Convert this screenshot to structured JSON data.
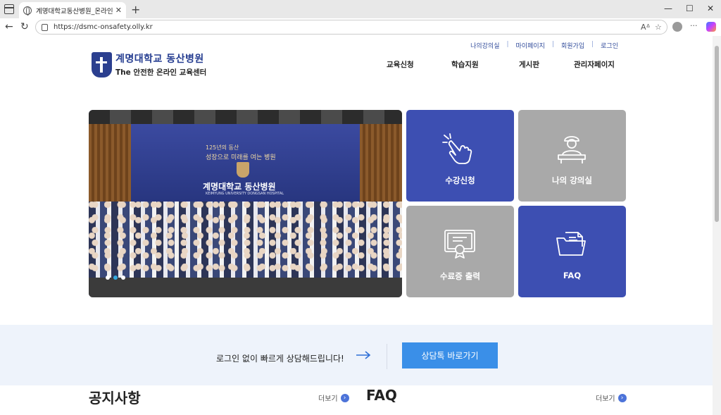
{
  "browser": {
    "tab_title": "계명대학교동산병원_온라인교육",
    "tab_close": "✕",
    "new_tab": "+",
    "url": "https://dsmc-onsafety.olly.kr",
    "window_controls": [
      "—",
      "☐",
      "✕"
    ]
  },
  "util_nav": [
    "나의강의실",
    "마이페이지",
    "회원가입",
    "로그인"
  ],
  "util_separator": "|",
  "logo": {
    "main": "계명대학교 동산병원",
    "sub": "The 안전한 온라인 교육센터"
  },
  "main_nav": [
    "교육신청",
    "학습지원",
    "게시판",
    "관리자페이지"
  ],
  "hero": {
    "banner_line1": "125년의 동산",
    "banner_line2": "성장으로 미래를 여는 병원",
    "banner_title": "계명대학교 동산병원",
    "banner_en": "KEIMYUNG UNIVERSITY DONGSAN HOSPITAL",
    "slide_count": 3,
    "active_slide": 2
  },
  "tiles": [
    {
      "label": "수강신청",
      "icon": "hand-click-icon",
      "color": "#3d4fb2"
    },
    {
      "label": "나의 강의실",
      "icon": "student-desk-icon",
      "color": "#a9a9a9"
    },
    {
      "label": "수료증 출력",
      "icon": "certificate-icon",
      "color": "#a9a9a9"
    },
    {
      "label": "FAQ",
      "icon": "folder-icon",
      "color": "#3d4fb2"
    }
  ],
  "consult": {
    "text": "로그인 없이 빠르게 상담해드립니다!",
    "button": "상담톡 바로가기"
  },
  "sections": [
    {
      "title": "공지사항",
      "more": "더보기"
    },
    {
      "title": "FAQ",
      "more": "더보기"
    }
  ],
  "colors": {
    "primary": "#3d4fb2",
    "tile_gray": "#a9a9a9",
    "consult_bg": "#eef3fb",
    "consult_button": "#3a8fe8"
  }
}
